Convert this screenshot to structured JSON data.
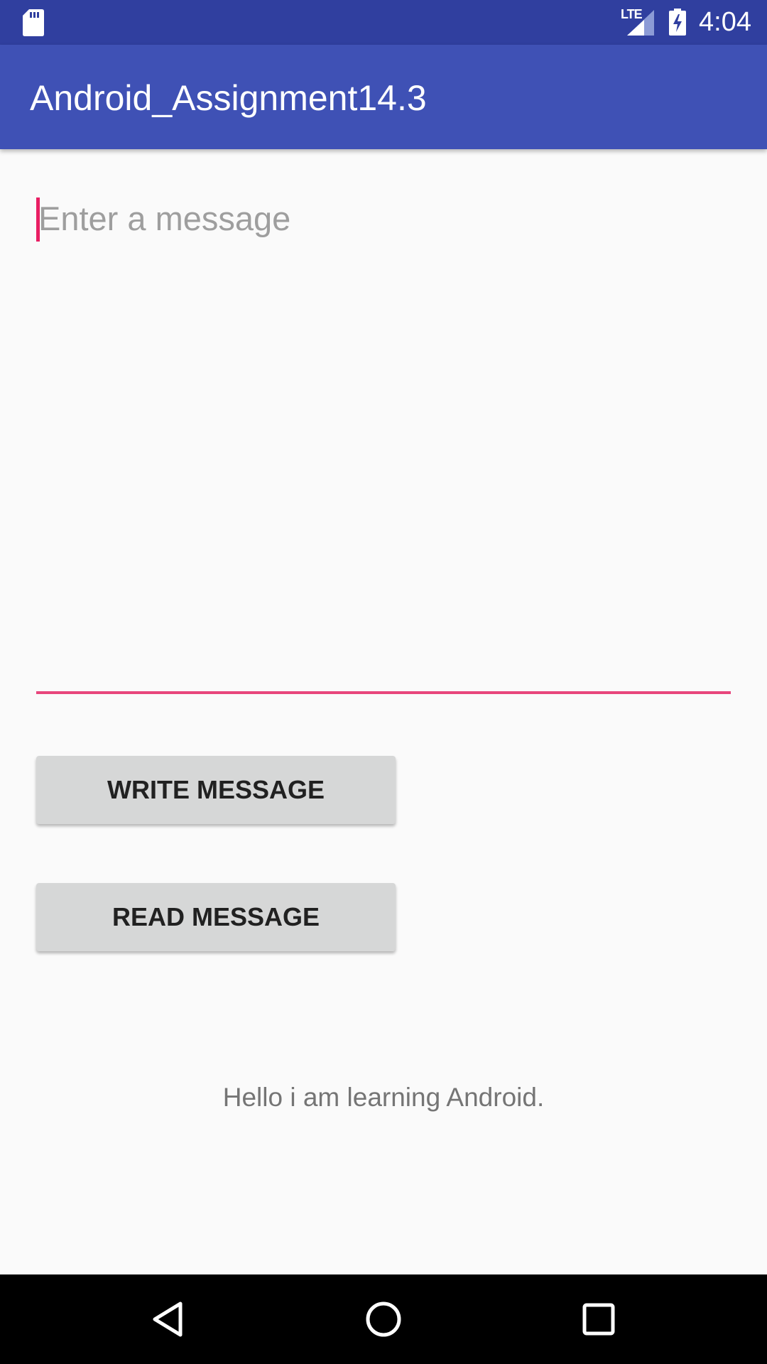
{
  "status_bar": {
    "network_label": "LTE",
    "time": "4:04",
    "icons": [
      "sd-card-icon",
      "signal-icon",
      "battery-charging-icon"
    ]
  },
  "app_bar": {
    "title": "Android_Assignment14.3"
  },
  "message_input": {
    "value": "",
    "placeholder": "Enter a message"
  },
  "buttons": {
    "write_label": "WRITE MESSAGE",
    "read_label": "READ MESSAGE"
  },
  "output": {
    "text": "Hello i am learning Android."
  },
  "nav_bar": {
    "icons": [
      "back-icon",
      "home-icon",
      "recents-icon"
    ]
  },
  "colors": {
    "primary": "#3f51b5",
    "primary_dark": "#303f9f",
    "accent": "#e91e63",
    "button_bg": "#d6d7d7",
    "background": "#fafafa"
  }
}
